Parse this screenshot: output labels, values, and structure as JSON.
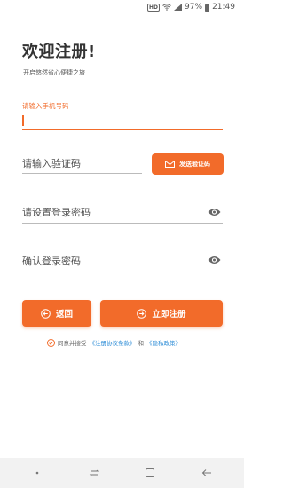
{
  "status_bar": {
    "hd_label": "HD",
    "battery": "97%",
    "time": "21:49"
  },
  "header": {
    "title": "欢迎注册!",
    "subtitle": "开启悠然省心便捷之旅"
  },
  "form": {
    "phone_label": "请输入手机号码",
    "phone_value": "",
    "code_placeholder": "请输入验证码",
    "send_code_label": "发送验证码",
    "password_placeholder": "请设置登录密码",
    "confirm_placeholder": "确认登录密码"
  },
  "actions": {
    "back_label": "返回",
    "register_label": "立即注册"
  },
  "agreement": {
    "prefix": "同意并接受",
    "terms_link": "《注册协议条款》",
    "and": "和",
    "privacy_link": "《隐私政策》"
  },
  "colors": {
    "accent": "#f26b2a",
    "link": "#2a8bd6"
  },
  "icons": {
    "send_code": "mail-icon",
    "password_visibility": "eye-icon",
    "back": "back-circle-icon",
    "register": "enter-circle-icon",
    "agree_check": "check-circle-icon"
  }
}
